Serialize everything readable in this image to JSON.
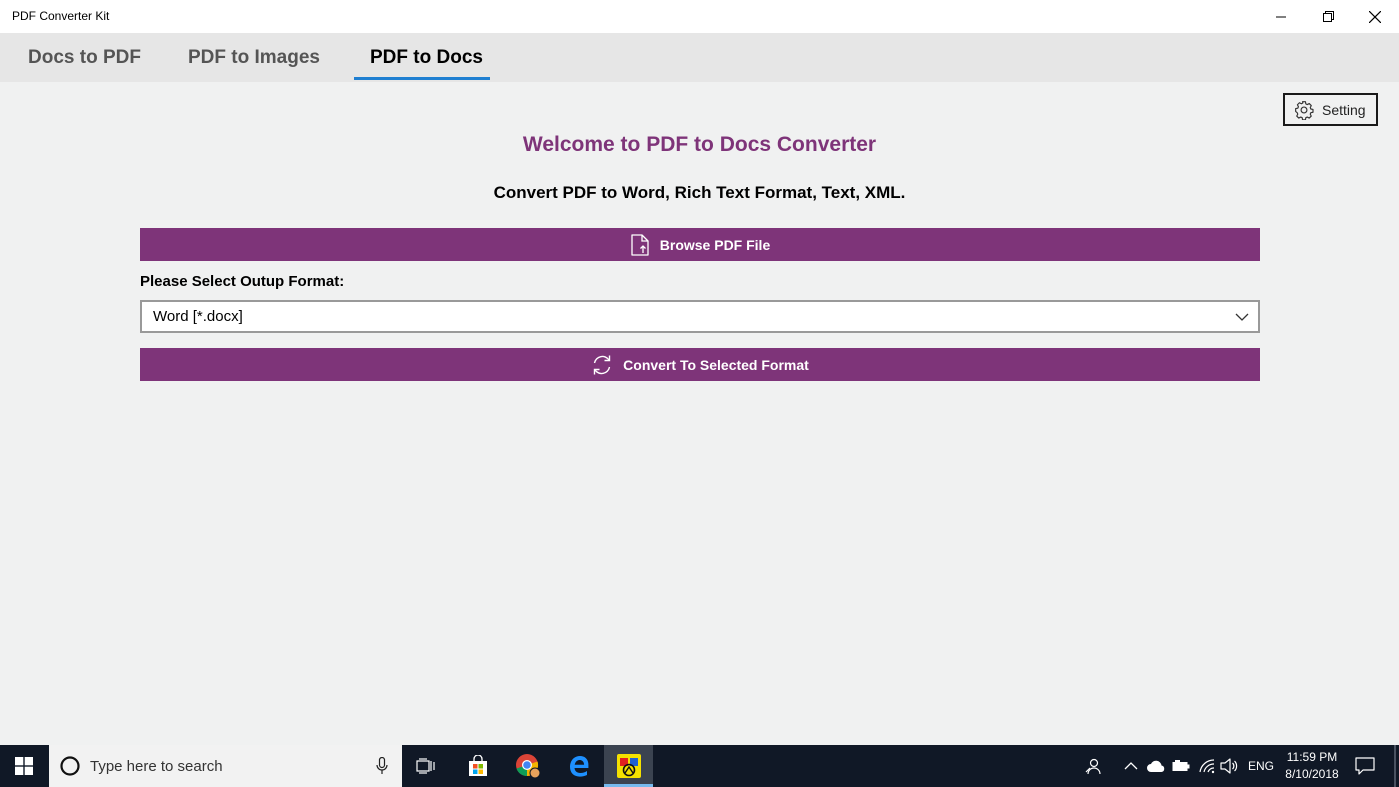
{
  "window": {
    "title": "PDF Converter Kit",
    "controls": [
      "minimize",
      "restore",
      "close"
    ]
  },
  "tabs": [
    {
      "label": "Docs to PDF",
      "active": false
    },
    {
      "label": "PDF to Images",
      "active": false
    },
    {
      "label": "PDF to Docs",
      "active": true
    }
  ],
  "setting": {
    "label": "Setting",
    "icon": "gear-icon"
  },
  "main": {
    "heading": "Welcome to PDF to Docs Converter",
    "subtitle": "Convert PDF to Word, Rich Text Format, Text, XML.",
    "browse_label": "Browse PDF File",
    "format_label": "Please Select Outup Format:",
    "format_value": "Word [*.docx]",
    "convert_label": "Convert To Selected Format"
  },
  "taskbar": {
    "search_placeholder": "Type here to search",
    "language": "ENG",
    "time": "11:59 PM",
    "date": "8/10/2018"
  },
  "colors": {
    "accent": "#7e3479",
    "tab_underline": "#1f7fd1",
    "taskbar": "#101826"
  }
}
